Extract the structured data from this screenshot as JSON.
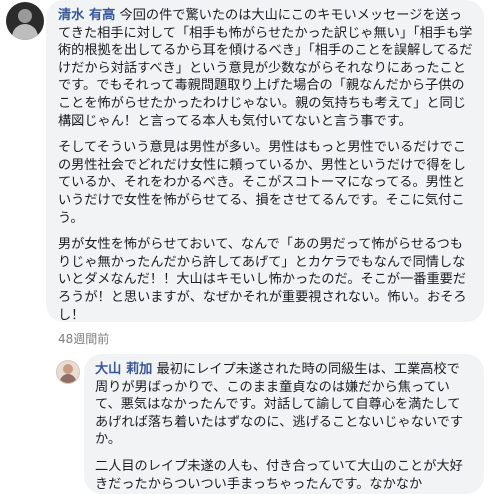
{
  "comment1": {
    "author": "清水 有高",
    "paragraphs": [
      "今回の件で驚いたのは大山にこのキモいメッセージを送ってきた相手に対して「相手も怖がらせたかった訳じゃ無い」「相手も学術的根拠を出してるから耳を傾けるべき」「相手のことを誤解してるだけだから対話すべき」という意見が少数ながらそれなりにあったことです。でもそれって毒親問題取り上げた場合の「親なんだから子供のことを怖がらせたかったわけじゃない。親の気持ちも考えて」と同じ構図じゃん！と言ってる本人も気付いてないと言う事です。",
      "そしてそういう意見は男性が多い。男性はもっと男性でいるだけでこの男性社会でどれだけ女性に頼っているか、男性というだけで得をしているか、それをわかるべき。そこがスコトーマになってる。男性というだけで女性を怖がらせてる、損をさせてるんです。そこに気付こう。",
      "男が女性を怖がらせておいて、なんで「あの男だって怖がらせるつもりじゃ無かったんだから許してあげて」とカケラでもなんで同情しないとダメなんだ！！大山はキモいし怖かったのだ。そこが一番重要だろうが！と思いますが、なぜかそれが重要視されない。怖い。おそろし！"
    ],
    "timestamp": "48週間前"
  },
  "comment2": {
    "author": "大山 莉加",
    "paragraphs": [
      "最初にレイプ未遂された時の同級生は、工業高校で周りが男ばっかりで、このまま童貞なのは嫌だから焦っていて、悪気はなかったんです。対話して諭して自尊心を満たしてあげれば落ち着いたはずなのに、逃げることないじゃないですか。",
      "二人目のレイプ未遂の人も、付き合っていて大山のことが大好きだったからついつい手まっちゃったんです。なかなか"
    ]
  }
}
